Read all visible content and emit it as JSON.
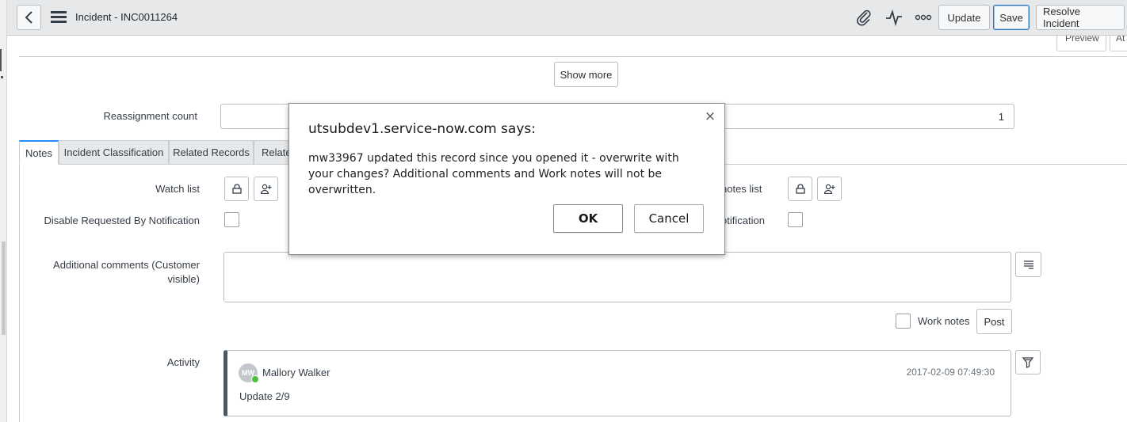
{
  "header": {
    "title": "Incident - INC0011264",
    "update_label": "Update",
    "save_label": "Save",
    "resolve_label": "Resolve Incident",
    "icons": [
      "back-icon",
      "menu-icon",
      "attachment-icon",
      "activity-icon",
      "more-icon"
    ]
  },
  "peek": {
    "preview_label": "Preview",
    "other_label": "At"
  },
  "form": {
    "show_more_label": "Show more",
    "reassignment_label": "Reassignment count",
    "reassignment_value": "1"
  },
  "tabs": [
    {
      "label": "Notes",
      "active": true
    },
    {
      "label": "Incident Classification",
      "active": false
    },
    {
      "label": "Related Records",
      "active": false
    },
    {
      "label": "Relate",
      "active": false
    }
  ],
  "notes": {
    "watch_list_label": "Watch list",
    "disable_label": "Disable Requested By Notification",
    "notes_list_label": "notes list",
    "notification_label": "otification",
    "comments_label": "Additional comments (Customer visible)",
    "work_notes_label": "Work notes",
    "post_label": "Post",
    "activity_label": "Activity"
  },
  "activity": {
    "initials": "MW",
    "author": "Mallory Walker",
    "timestamp": "2017-02-09 07:49:30",
    "text": "Update 2/9"
  },
  "dialog": {
    "title": "utsubdev1.service-now.com says:",
    "message": "mw33967 updated this record since you opened it - overwrite with your changes? Additional comments and Work notes will not be overwritten.",
    "ok_label": "OK",
    "cancel_label": "Cancel",
    "close_symbol": "×"
  },
  "colors": {
    "active_tab": "#278efc",
    "save_border": "#2b74b4",
    "presence": "#4fbf3c"
  }
}
